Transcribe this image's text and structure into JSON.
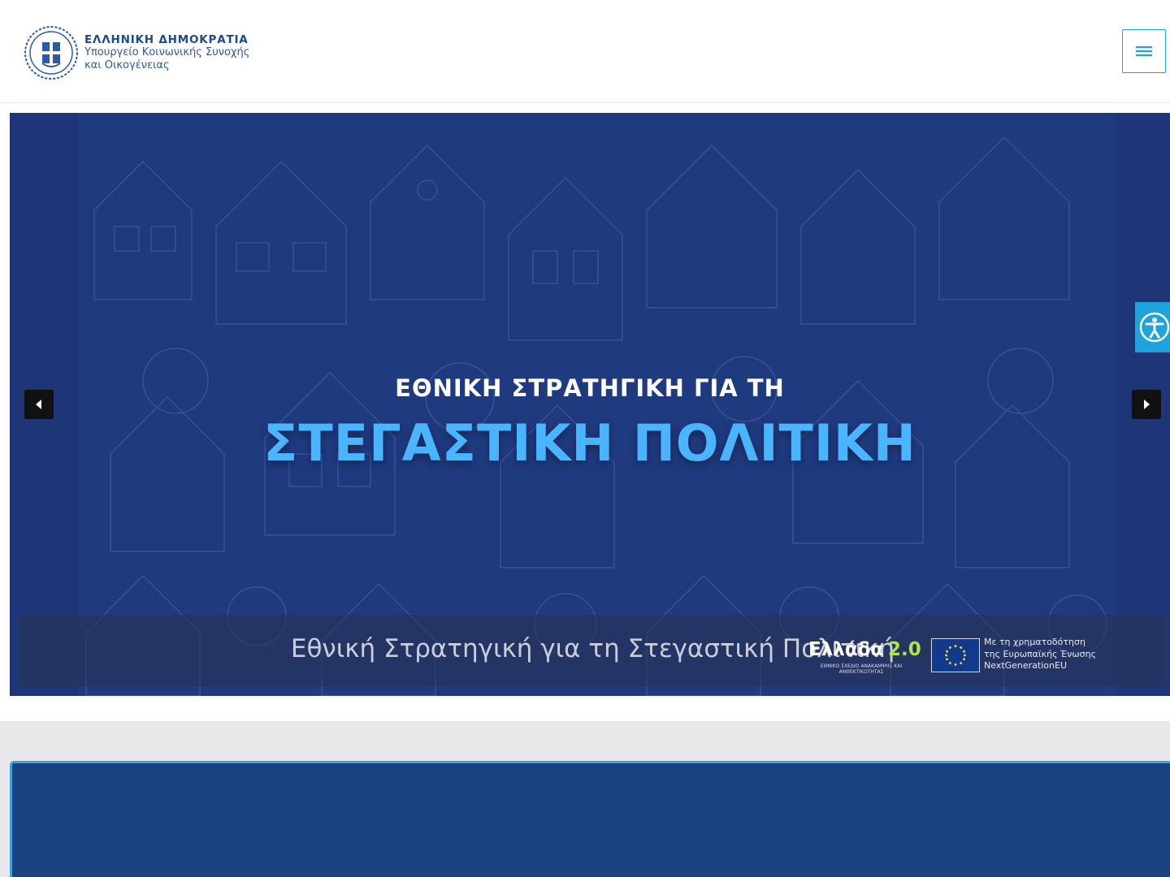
{
  "header": {
    "brand_line1": "ΕΛΛΗΝΙΚΗ ΔΗΜΟΚΡΑΤΙΑ",
    "brand_line2": "Υπουργείο Κοινωνικής Συνοχής",
    "brand_line3": "και Οικογένειας",
    "menu_icon": "hamburger-icon",
    "accent_color": "#1fa3dd"
  },
  "hero": {
    "subtitle": "ΕΘΝΙΚΗ ΣΤΡΑΤΗΓΙΚΗ ΓΙΑ ΤΗ",
    "title": "ΣΤΕΓΑΣΤΙΚΗ ΠΟΛΙΤΙΚΗ",
    "caption": "Εθνική Στρατηγική για τη Στεγαστική Πολιτική",
    "prev_icon": "caret-left-icon",
    "next_icon": "caret-right-icon",
    "logo_greece_word": "Ελλάδα",
    "logo_greece_num": "2.0",
    "logo_greece_small": "ΕΘΝΙΚΟ ΣΧΕΔΙΟ ΑΝΑΚΑΜΨΗΣ ΚΑΙ ΑΝΘΕΚΤΙΚΟΤΗΤΑΣ",
    "eu_line1": "Με τη χρηματοδότηση",
    "eu_line2": "της Ευρωπαϊκής Ένωσης",
    "eu_line3": "NextGenerationEU"
  },
  "accessibility": {
    "icon": "accessibility-icon"
  }
}
